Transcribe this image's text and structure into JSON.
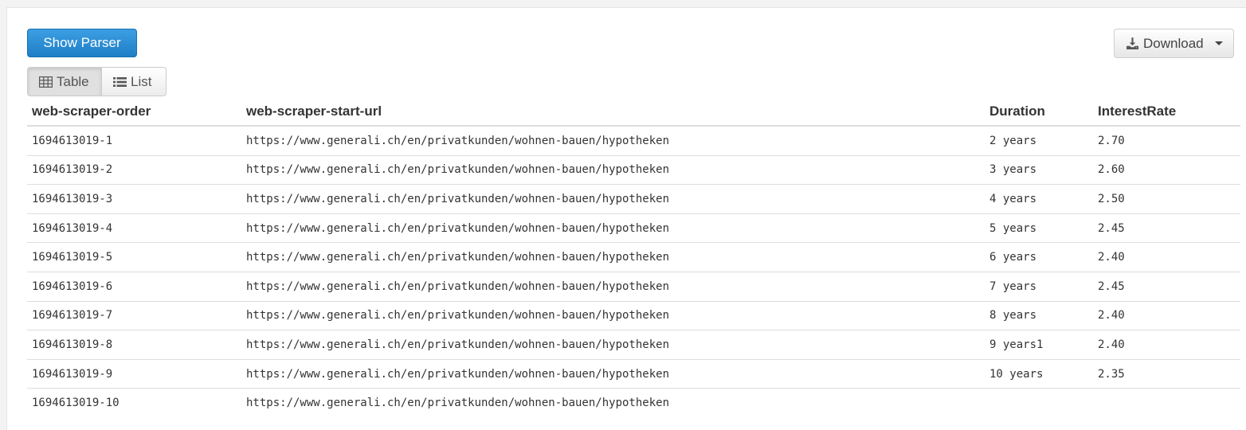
{
  "toolbar": {
    "show_parser_label": "Show Parser",
    "download_label": "Download"
  },
  "view_toggle": {
    "table_label": "Table",
    "list_label": "List",
    "active": "Table"
  },
  "table": {
    "columns": [
      "web-scraper-order",
      "web-scraper-start-url",
      "Duration",
      "InterestRate"
    ],
    "rows": [
      [
        "1694613019-1",
        "https://www.generali.ch/en/privatkunden/wohnen-bauen/hypotheken",
        "2 years",
        "2.70"
      ],
      [
        "1694613019-2",
        "https://www.generali.ch/en/privatkunden/wohnen-bauen/hypotheken",
        "3 years",
        "2.60"
      ],
      [
        "1694613019-3",
        "https://www.generali.ch/en/privatkunden/wohnen-bauen/hypotheken",
        "4 years",
        "2.50"
      ],
      [
        "1694613019-4",
        "https://www.generali.ch/en/privatkunden/wohnen-bauen/hypotheken",
        "5 years",
        "2.45"
      ],
      [
        "1694613019-5",
        "https://www.generali.ch/en/privatkunden/wohnen-bauen/hypotheken",
        "6 years",
        "2.40"
      ],
      [
        "1694613019-6",
        "https://www.generali.ch/en/privatkunden/wohnen-bauen/hypotheken",
        "7 years",
        "2.45"
      ],
      [
        "1694613019-7",
        "https://www.generali.ch/en/privatkunden/wohnen-bauen/hypotheken",
        "8 years",
        "2.40"
      ],
      [
        "1694613019-8",
        "https://www.generali.ch/en/privatkunden/wohnen-bauen/hypotheken",
        "9 years1",
        "2.40"
      ],
      [
        "1694613019-9",
        "https://www.generali.ch/en/privatkunden/wohnen-bauen/hypotheken",
        "10 years",
        "2.35"
      ],
      [
        "1694613019-10",
        "https://www.generali.ch/en/privatkunden/wohnen-bauen/hypotheken",
        "",
        ""
      ]
    ]
  },
  "colors": {
    "primary": "#2c8fd6",
    "border": "#dddddd"
  },
  "icons": {
    "download": "download-icon",
    "table": "table-icon",
    "list": "list-icon",
    "caret": "caret-down-icon"
  }
}
